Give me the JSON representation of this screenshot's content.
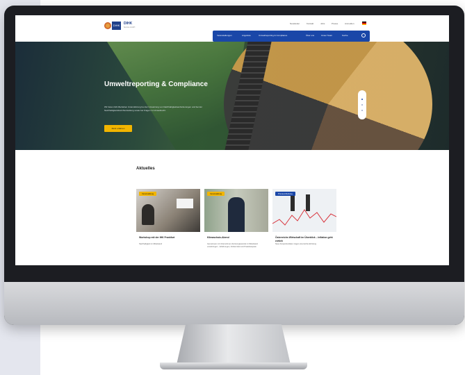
{
  "header": {
    "logo_box": "DIHK",
    "logo_name": "DIHK",
    "logo_sub": "Service GmbH",
    "utility_links": [
      "Newsletter",
      "Kontakt",
      "Jobs",
      "Presse",
      "Anmelden"
    ],
    "nav_items": [
      "Veranstaltungen",
      "Angebote",
      "Umweltreporting & Compliance",
      "Über uns",
      "Unser Team",
      "Suche"
    ]
  },
  "hero": {
    "title": "Umweltreporting & Compliance",
    "body": "Wir bieten IHK-Betrieben Unterstützung bei der Umsetzung von Nachhaltigkeitsanforderungen und bei der Nachhaltigkeitsberichterstattung sowie bei Fragen zu Umweltrecht.",
    "button_label": "Mehr erfahren"
  },
  "news": {
    "heading": "Aktuelles",
    "cards": [
      {
        "badge": "Veranstaltung",
        "title": "Workshop mit der IHK Frankfurt",
        "text": "Nachhaltigkeit im Mittelstand"
      },
      {
        "badge": "Veranstaltung",
        "title": "Klimaschutz-Abend",
        "text": "Gemeinsam mit Unternehmen die Energiewende im Mittelstand voranbringen – Erfahrungen, Fördermittel und Praxisbeispiele"
      },
      {
        "badge": "Pressemitteilung",
        "title": "Österreichs Wirtschaft im Überblick – Inflation geht zurück",
        "text": "Neue Konjunkturdaten zeigen eine leichte Erholung"
      }
    ]
  },
  "colors": {
    "brand": "#1a47a8",
    "accent": "#f2b500"
  }
}
